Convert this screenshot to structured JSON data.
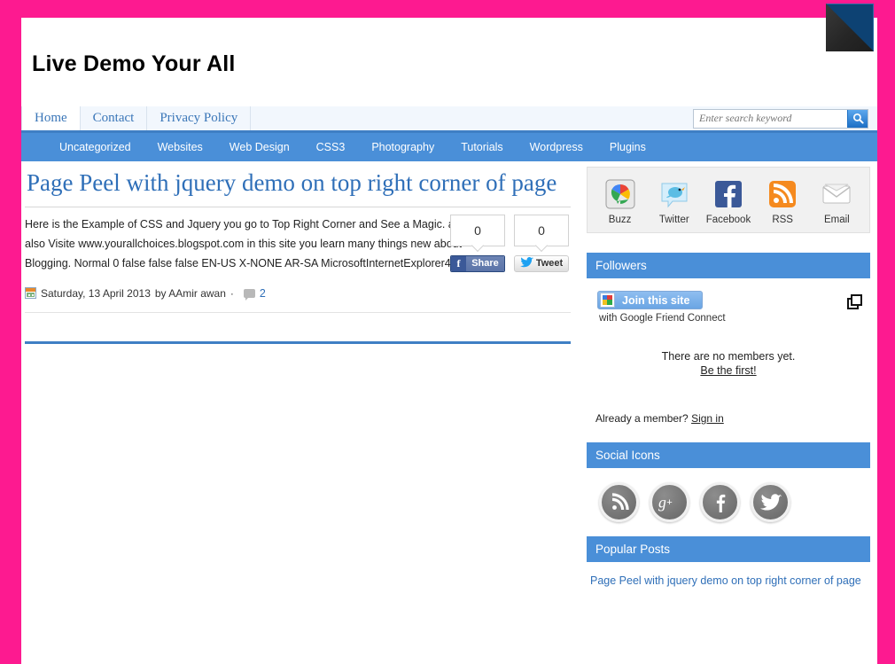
{
  "site": {
    "title": "Live Demo Your All"
  },
  "top_nav": {
    "tabs": [
      {
        "label": "Home",
        "active": true
      },
      {
        "label": "Contact",
        "active": false
      },
      {
        "label": "Privacy Policy",
        "active": false
      }
    ]
  },
  "search": {
    "placeholder": "Enter search keyword",
    "value": "",
    "icon": "search-icon"
  },
  "category_nav": {
    "items": [
      "Uncategorized",
      "Websites",
      "Web Design",
      "CSS3",
      "Photography",
      "Tutorials",
      "Wordpress",
      "Plugins"
    ]
  },
  "post": {
    "title": "Page Peel with jquery demo on top right corner of page",
    "excerpt": "Here is the Example of CSS and Jquery you go to Top Right Corner and See a Magic. and also Visite www.yourallchoices.blogspot.com in this site you learn many things new about Blogging. Normal 0 false false false EN-US X-NONE AR-SA MicrosoftInternetExplorer4 ...",
    "date": "Saturday, 13 April 2013",
    "byline": "by AAmir awan",
    "meta_separator": "·",
    "comment_count": "2",
    "share": {
      "facebook": {
        "count": "0",
        "label": "Share",
        "glyph": "f"
      },
      "twitter": {
        "count": "0",
        "label": "Tweet"
      }
    }
  },
  "sidebar": {
    "share_icons": [
      {
        "name": "buzz",
        "label": "Buzz"
      },
      {
        "name": "twitter",
        "label": "Twitter"
      },
      {
        "name": "facebook",
        "label": "Facebook"
      },
      {
        "name": "rss",
        "label": "RSS"
      },
      {
        "name": "email",
        "label": "Email"
      }
    ],
    "followers": {
      "title": "Followers",
      "join_label": "Join this site",
      "join_sub": "with Google Friend Connect",
      "empty_text": "There are no members yet.",
      "be_first": "Be the first!",
      "already_member": "Already a member?",
      "sign_in": "Sign in"
    },
    "social_icons": {
      "title": "Social Icons",
      "items": [
        "rss",
        "google-plus",
        "facebook",
        "twitter"
      ]
    },
    "popular_posts": {
      "title": "Popular Posts",
      "items": [
        "Page Peel with jquery demo on top right corner of page"
      ]
    }
  },
  "colors": {
    "frame_pink": "#fd1a90",
    "nav_blue": "#4a8fd8",
    "link_blue": "#2f6fb8",
    "peel_under": "#0d4273"
  }
}
